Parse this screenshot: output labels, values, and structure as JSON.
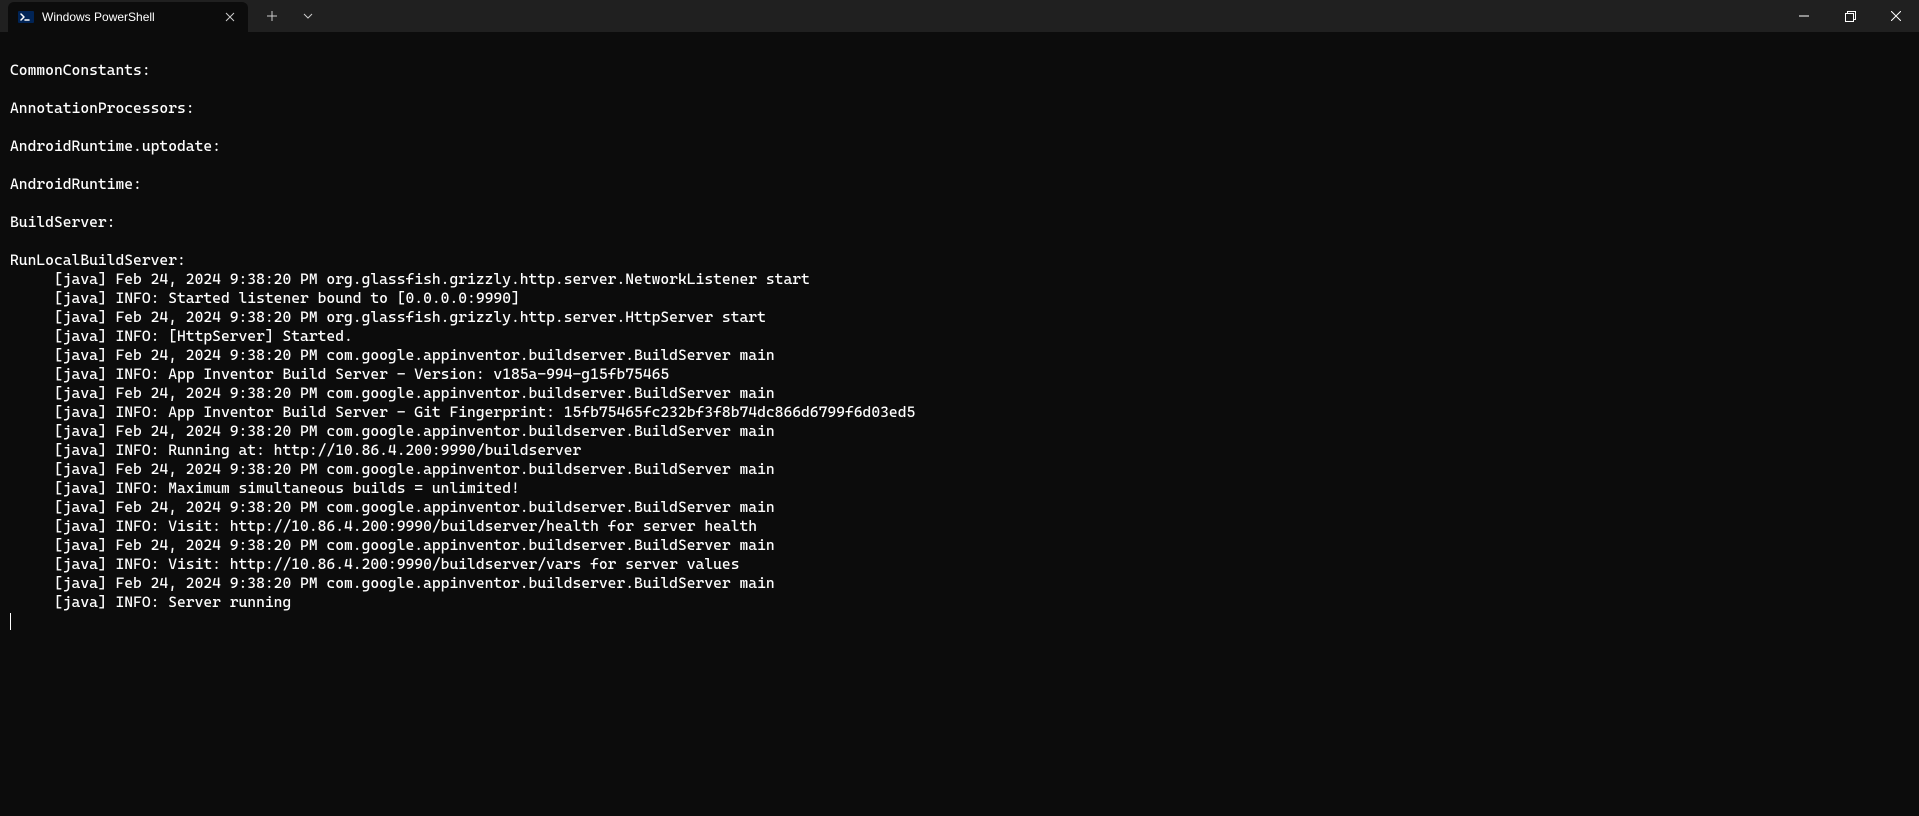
{
  "tab": {
    "title": "Windows PowerShell"
  },
  "terminal": {
    "lines": [
      "",
      "CommonConstants:",
      "",
      "AnnotationProcessors:",
      "",
      "AndroidRuntime.uptodate:",
      "",
      "AndroidRuntime:",
      "",
      "BuildServer:",
      "",
      "RunLocalBuildServer:",
      "     [java] Feb 24, 2024 9:38:20 PM org.glassfish.grizzly.http.server.NetworkListener start",
      "     [java] INFO: Started listener bound to [0.0.0.0:9990]",
      "     [java] Feb 24, 2024 9:38:20 PM org.glassfish.grizzly.http.server.HttpServer start",
      "     [java] INFO: [HttpServer] Started.",
      "     [java] Feb 24, 2024 9:38:20 PM com.google.appinventor.buildserver.BuildServer main",
      "     [java] INFO: App Inventor Build Server - Version: v185a-994-g15fb75465",
      "     [java] Feb 24, 2024 9:38:20 PM com.google.appinventor.buildserver.BuildServer main",
      "     [java] INFO: App Inventor Build Server - Git Fingerprint: 15fb75465fc232bf3f8b74dc866d6799f6d03ed5",
      "     [java] Feb 24, 2024 9:38:20 PM com.google.appinventor.buildserver.BuildServer main",
      "     [java] INFO: Running at: http://10.86.4.200:9990/buildserver",
      "     [java] Feb 24, 2024 9:38:20 PM com.google.appinventor.buildserver.BuildServer main",
      "     [java] INFO: Maximum simultaneous builds = unlimited!",
      "     [java] Feb 24, 2024 9:38:20 PM com.google.appinventor.buildserver.BuildServer main",
      "     [java] INFO: Visit: http://10.86.4.200:9990/buildserver/health for server health",
      "     [java] Feb 24, 2024 9:38:20 PM com.google.appinventor.buildserver.BuildServer main",
      "     [java] INFO: Visit: http://10.86.4.200:9990/buildserver/vars for server values",
      "     [java] Feb 24, 2024 9:38:20 PM com.google.appinventor.buildserver.BuildServer main",
      "     [java] INFO: Server running"
    ]
  }
}
